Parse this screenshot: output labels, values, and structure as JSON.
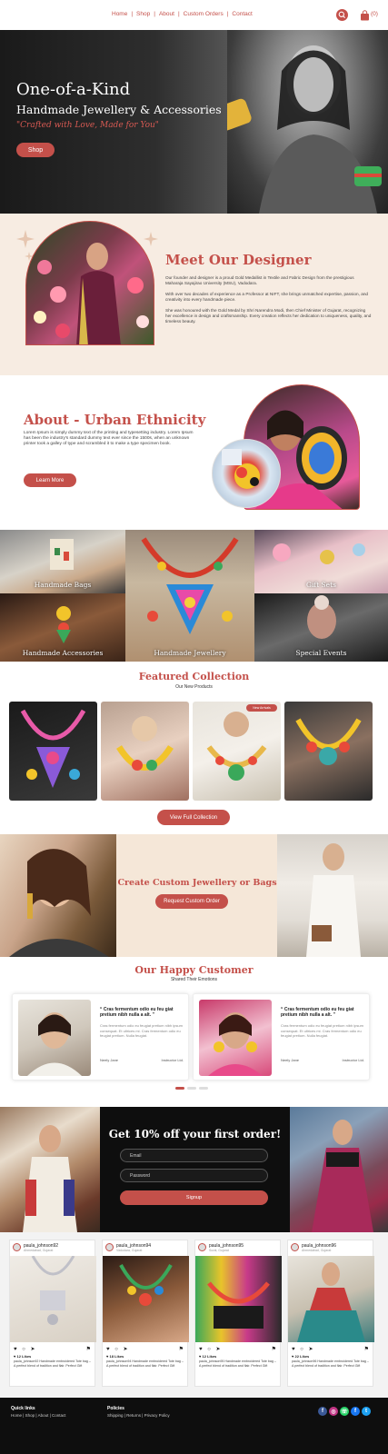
{
  "nav": {
    "links": [
      "Home",
      "Shop",
      "About",
      "Custom Orders",
      "Contact"
    ],
    "separator": "|",
    "cart_count": "(0)",
    "icons": {
      "search": "search-icon",
      "bag": "shopping-bag-icon"
    },
    "accent": "#c4504a"
  },
  "hero": {
    "title": "One-of-a-Kind",
    "subtitle": "Handmade Jewellery & Accessories",
    "tagline": "\"Crafted with Love, Made for You\"",
    "cta": "Shop"
  },
  "designer": {
    "heading": "Meet Our Designer",
    "paragraphs": [
      "Our founder and designer is a proud Gold Medallist in Textile and Fabric Design from the prestigious Maharaja Sayajirao University (MSU), Vadodara.",
      "With over two decades of experience as a Professor at NIFT, she brings unmatched expertise, passion, and creativity into every handmade piece.",
      "She was honoured with the Gold Medal by Shri Narendra Modi, then Chief Minister of Gujarat, recognizing her excellence in design and craftsmanship. Every creation reflects her dedication to uniqueness, quality, and timeless beauty."
    ]
  },
  "about": {
    "heading": "About - Urban Ethnicity",
    "text": "Lorem Ipsum is simply dummy text of the printing and typesetting industry. Lorem Ipsum has been the industry's standard dummy text ever since the 1500s, when an unknown printer took a galley of type and scrambled it to make a type specimen book.",
    "cta": "Learn More"
  },
  "categories": [
    {
      "label": "Handmade Bags"
    },
    {
      "label": ""
    },
    {
      "label": "Gift Sets"
    },
    {
      "label": "Handmade Accessories"
    },
    {
      "label": "Handmade Jewellery"
    },
    {
      "label": "Special Events"
    }
  ],
  "featured": {
    "heading": "Featured Collection",
    "sub": "Our New Products",
    "badge": "New Arrivals",
    "cta": "View Full Collection"
  },
  "custom": {
    "heading": "Create Custom Jewellery or Bags",
    "cta": "Request Custom Order"
  },
  "testimonials": {
    "heading": "Our Happy Customer",
    "sub": "Shared Their Emotions",
    "cards": [
      {
        "quote": "“ Cras fermentum odio eu feu giat pretium nibh nulla a alt. ”",
        "body": "Cras fermentum odio eu feugiat pretium nibh ipsum consequat. Et ultrices mi. Cras fermentum odio eu feugiat pretium. Nulla feugiat.",
        "name": "Neely Jane",
        "role": "Instructor Ltd."
      },
      {
        "quote": "“ Cras fermentum odio eu feu giat pretium nibh nulla a alt. ”",
        "body": "Cras fermentum odio eu feugiat pretium nibh ipsum consequat. Et ultrices mi. Cras fermentum odio eu feugiat pretium. Nulla feugiat.",
        "name": "Neely Jane",
        "role": "Instructor Ltd."
      }
    ]
  },
  "signup": {
    "heading": "Get 10% off your first order!",
    "email_placeholder": "Email",
    "password_placeholder": "Password",
    "cta": "Signup"
  },
  "instagram": [
    {
      "user": "paula_johnson92",
      "loc": "Ahmedabad, Gujarat",
      "likes": "♥ 12 Likes",
      "caption": "paula_johnson92 Handmade embroidered Tote bag – A perfect blend of tradition and flair. Perfect Gift"
    },
    {
      "user": "paula_johnson94",
      "loc": "Vadodara, Gujarat",
      "likes": "♥ 18 Likes",
      "caption": "paula_johnson94 Handmade embroidered Tote bag – A perfect blend of tradition and flair. Perfect Gift"
    },
    {
      "user": "paula_johnson95",
      "loc": "Surat, Gujarat",
      "likes": "♥ 12 Likes",
      "caption": "paula_johnson95 Handmade embroidered Tote bag – A perfect blend of tradition and flair. Perfect Gift"
    },
    {
      "user": "paula_johnson96",
      "loc": "Ahmedabad, Gujarat",
      "likes": "♥ 22 Likes",
      "caption": "paula_johnson96 Handmade embroidered Tote bag – A perfect blend of tradition and flair. Perfect Gift"
    }
  ],
  "footer": {
    "quick_title": "Quick links",
    "quick_links": "Home | Shop | About | Contact",
    "policy_title": "Policies",
    "policy_links": "Shipping | Returns | Privacy Policy",
    "social": [
      {
        "icon": "facebook-icon",
        "glyph": "f",
        "color": "#3b5998"
      },
      {
        "icon": "instagram-icon",
        "glyph": "◎",
        "color": "#c13584"
      },
      {
        "icon": "whatsapp-icon",
        "glyph": "☏",
        "color": "#25d366"
      },
      {
        "icon": "facebook-alt-icon",
        "glyph": "f",
        "color": "#1877f2"
      },
      {
        "icon": "twitter-icon",
        "glyph": "t",
        "color": "#1da1f2"
      }
    ]
  }
}
